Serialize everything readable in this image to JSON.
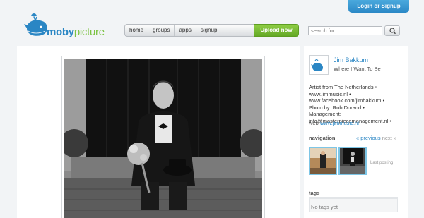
{
  "header": {
    "login_label": "Login or Signup",
    "logo_text_a": "moby",
    "logo_text_b": "picture",
    "nav": [
      "home",
      "groups",
      "apps",
      "signup"
    ],
    "upload_label": "Upload now",
    "search_placeholder": "search for..."
  },
  "profile": {
    "name": "Jim Bakkum",
    "tagline": "Where I Want To Be",
    "bio_lines": [
      "Artist from The Netherlands •",
      "www.jimmusic.nl •",
      "www.facebook.com/jimbakkum •",
      "Photo by: Rob Durand •",
      "Management:",
      "info@masterpiecemanagement.nl •"
    ],
    "web_label": "web",
    "web_link": "www.jimmusic.nl"
  },
  "navigation": {
    "title": "navigation",
    "previous": "« previous",
    "next": "next »",
    "last_posting": "Last posting"
  },
  "tags": {
    "title": "tags",
    "empty": "No tags yet"
  },
  "colors": {
    "brand_blue": "#2a86c4",
    "brand_green": "#7cc242",
    "upload_green": "#64a925",
    "login_blue": "#2b88c6"
  }
}
